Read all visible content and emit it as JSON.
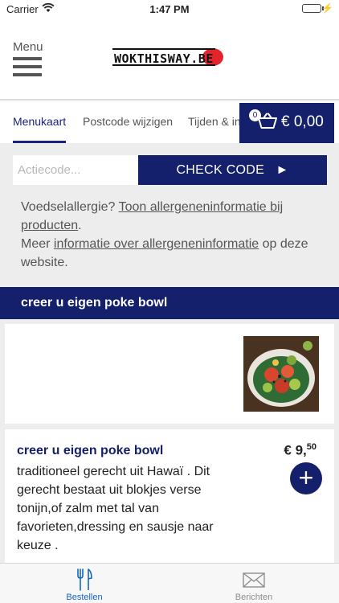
{
  "status_bar": {
    "carrier": "Carrier",
    "time": "1:47 PM"
  },
  "header": {
    "menu_label": "Menu",
    "logo_text": "WOKTHISWAY.BE"
  },
  "tabs": [
    {
      "label": "Menukaart",
      "active": true
    },
    {
      "label": "Postcode wijzigen",
      "active": false
    },
    {
      "label": "Tijden & in",
      "active": false
    }
  ],
  "cart": {
    "count": "0",
    "amount": "€ 0,00"
  },
  "promo": {
    "placeholder": "Actiecode...",
    "button": "CHECK CODE"
  },
  "allergy": {
    "question": "Voedselallergie?",
    "link1": "Toon allergeneninformatie bij producten",
    "period": ".",
    "more": "Meer",
    "link2": "informatie over allergeneninformatie",
    "suffix": "op deze website."
  },
  "section": {
    "title": "creer u eigen poke bowl"
  },
  "product": {
    "name": "creer u eigen poke bowl",
    "price_main": "€ 9,",
    "price_cents": "50",
    "description": "traditioneel gerecht uit Hawaï . Dit gerecht bestaat uit blokjes verse tonijn,of zalm met tal van favorieten,dressing en sausje naar keuze ."
  },
  "tabbar": [
    {
      "label": "Bestellen",
      "icon": "fork-knife-icon",
      "active": true
    },
    {
      "label": "Berichten",
      "icon": "envelope-icon",
      "active": false
    }
  ],
  "colors": {
    "brand": "#14206b",
    "accent_red": "#e3252b",
    "active_tab": "#1565c0"
  }
}
